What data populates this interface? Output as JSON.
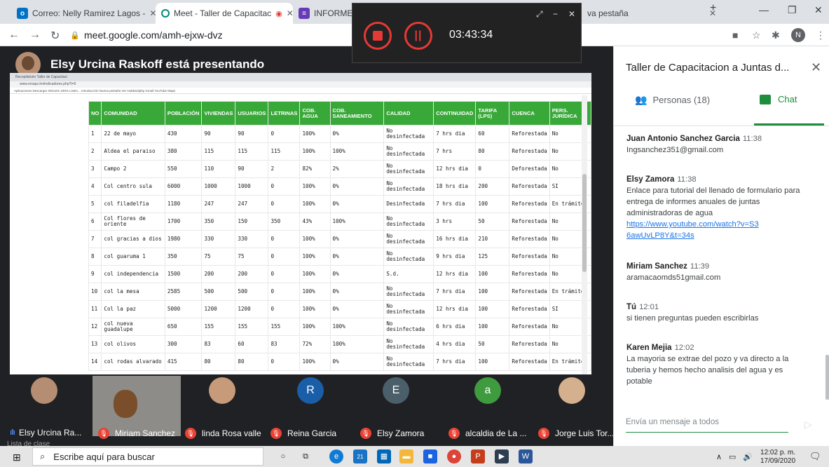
{
  "browser": {
    "tabs": [
      {
        "label": "Correo: Nelly Ramirez Lagos - ",
        "icon": "mail-icon"
      },
      {
        "label": "Meet - Taller de Capacitac",
        "icon": "meet-icon"
      },
      {
        "label": "INFORME ANU",
        "icon": "forms-icon"
      },
      {
        "label": "va pestaña",
        "icon": "new-tab-icon"
      }
    ],
    "url": "meet.google.com/amh-ejxw-dvz",
    "profile_initial": "N"
  },
  "recorder": {
    "time": "03:43:34"
  },
  "meet": {
    "presenting_label": "Elsy Urcina Raskoff está presentando",
    "shared_tab_label": "Recopilatorio Taller de Capacitaci",
    "shared_url": "www.ersaps.hn/indicadores.php?t=5",
    "shared_bookmarks": "Aplicaciones   Descargar   INGLES 100% Listen...   Introducción   Nueva pestaña   Ver Hubbardphp   Gmail   YouTube   Maps",
    "table": {
      "headers": [
        "NO",
        "COMUNIDAD",
        "POBLACIÓN",
        "VIVIENDAS",
        "USUARIOS",
        "LETRINAS",
        "COB. AGUA",
        "COB. SANEAMIENTO",
        "CALIDAD",
        "CONTINUIDAD",
        "TARIFA (LPS)",
        "CUENCA",
        "PERS. JURÍDICA"
      ],
      "rows": [
        [
          "1",
          "22 de mayo",
          "430",
          "90",
          "90",
          "0",
          "100%",
          "0%",
          "No desinfectada",
          "7 hrs dia",
          "60",
          "Reforestada",
          "No"
        ],
        [
          "2",
          "Aldea el paraiso",
          "380",
          "115",
          "115",
          "115",
          "100%",
          "100%",
          "No desinfectada",
          "7 hrs",
          "80",
          "Reforestada",
          "No"
        ],
        [
          "3",
          "Campo 2",
          "550",
          "110",
          "90",
          "2",
          "82%",
          "2%",
          "No desinfectada",
          "12 hrs dia",
          "0",
          "Deforestada",
          "No"
        ],
        [
          "4",
          "Col centro sula",
          "6000",
          "1000",
          "1000",
          "0",
          "100%",
          "0%",
          "No desinfectada",
          "18 hrs dia",
          "200",
          "Reforestada",
          "SI"
        ],
        [
          "5",
          "col filadelfia",
          "1180",
          "247",
          "247",
          "0",
          "100%",
          "0%",
          "Desinfectada",
          "7 hrs dia",
          "100",
          "Reforestada",
          "En trámite"
        ],
        [
          "6",
          "Col flores de oriente",
          "1700",
          "350",
          "150",
          "350",
          "43%",
          "100%",
          "No desinfectada",
          "3 hrs",
          "50",
          "Reforestada",
          "No"
        ],
        [
          "7",
          "col gracias a dios",
          "1980",
          "330",
          "330",
          "0",
          "100%",
          "0%",
          "No desinfectada",
          "16 hrs dia",
          "210",
          "Reforestada",
          "No"
        ],
        [
          "8",
          "col guaruma 1",
          "350",
          "75",
          "75",
          "0",
          "100%",
          "0%",
          "No desinfectada",
          "9 hrs dia",
          "125",
          "Reforestada",
          "No"
        ],
        [
          "9",
          "col independencia",
          "1500",
          "200",
          "200",
          "0",
          "100%",
          "0%",
          "S.d.",
          "12 hrs dia",
          "100",
          "Reforestada",
          "No"
        ],
        [
          "10",
          "col la mesa",
          "2585",
          "500",
          "500",
          "0",
          "100%",
          "0%",
          "No desinfectada",
          "7 hrs dia",
          "100",
          "Reforestada",
          "En trámite"
        ],
        [
          "11",
          "Col la paz",
          "5000",
          "1200",
          "1200",
          "0",
          "100%",
          "0%",
          "No desinfectada",
          "12 hrs dia",
          "100",
          "Reforestada",
          "SI"
        ],
        [
          "12",
          "col nueva guadalupe",
          "650",
          "155",
          "155",
          "155",
          "100%",
          "100%",
          "No desinfectada",
          "6 hrs dia",
          "100",
          "Reforestada",
          "No"
        ],
        [
          "13",
          "col olivos",
          "300",
          "83",
          "60",
          "83",
          "72%",
          "100%",
          "No desinfectada",
          "4 hrs dia",
          "50",
          "Reforestada",
          "No"
        ],
        [
          "14",
          "col rodas alvarado",
          "415",
          "80",
          "80",
          "0",
          "100%",
          "0%",
          "No desinfectada",
          "7 hrs dia",
          "100",
          "Reforestada",
          "En trámite"
        ]
      ]
    },
    "participants": [
      {
        "name": "Elsy Urcina Ra...",
        "initial": "",
        "color": "#b58d72"
      },
      {
        "name": "Miriam Sanchez",
        "initial": "",
        "color": "#8d8c88"
      },
      {
        "name": "linda Rosa valle",
        "initial": "",
        "color": "#c79b7a"
      },
      {
        "name": "Reina Garcia",
        "initial": "R",
        "color": "#1a5ea8"
      },
      {
        "name": "Elsy Zamora",
        "initial": "E",
        "color": "#4a5f6a"
      },
      {
        "name": "alcaldia de La ...",
        "initial": "a",
        "color": "#3e9b3e"
      },
      {
        "name": "Jorge Luis Tor...",
        "initial": "",
        "color": "#d5b08e"
      }
    ],
    "lista_label": "Lista de clase"
  },
  "panel": {
    "title": "Taller de Capacitacion a Juntas d...",
    "people_tab": "Personas (18)",
    "chat_tab": "Chat",
    "messages": [
      {
        "author": "Juan Antonio Sanchez Garcia",
        "time": "11:38",
        "lines": [
          "Ingsanchez351@gmail.com"
        ]
      },
      {
        "author": "Elsy Zamora",
        "time": "11:38",
        "lines": [
          "Enlace para tutorial del llenado de formulario para",
          "entrega de informes anuales de juntas",
          "administradoras de agua"
        ],
        "link": "https://www.youtube.com/watch?v=S36awUvLP8Y&t=34s"
      },
      {
        "author": "Miriam Sanchez",
        "time": "11:39",
        "lines": [
          "aramacaomds51gmail.com"
        ]
      },
      {
        "author": "Tú",
        "time": "12:01",
        "lines": [
          "si tienen preguntas pueden escribirlas"
        ]
      },
      {
        "author": "Karen Mejia",
        "time": "12:02",
        "lines": [
          "La mayoria se extrae del pozo y va directo a la",
          "tuberia y hemos hecho analisis del agua y es",
          "potable"
        ]
      }
    ],
    "input_placeholder": "Envía un mensaje a todos"
  },
  "taskbar": {
    "search_placeholder": "Escribe aquí para buscar",
    "mail_badge": "21",
    "time": "12:02 p. m.",
    "date": "17/09/2020"
  }
}
